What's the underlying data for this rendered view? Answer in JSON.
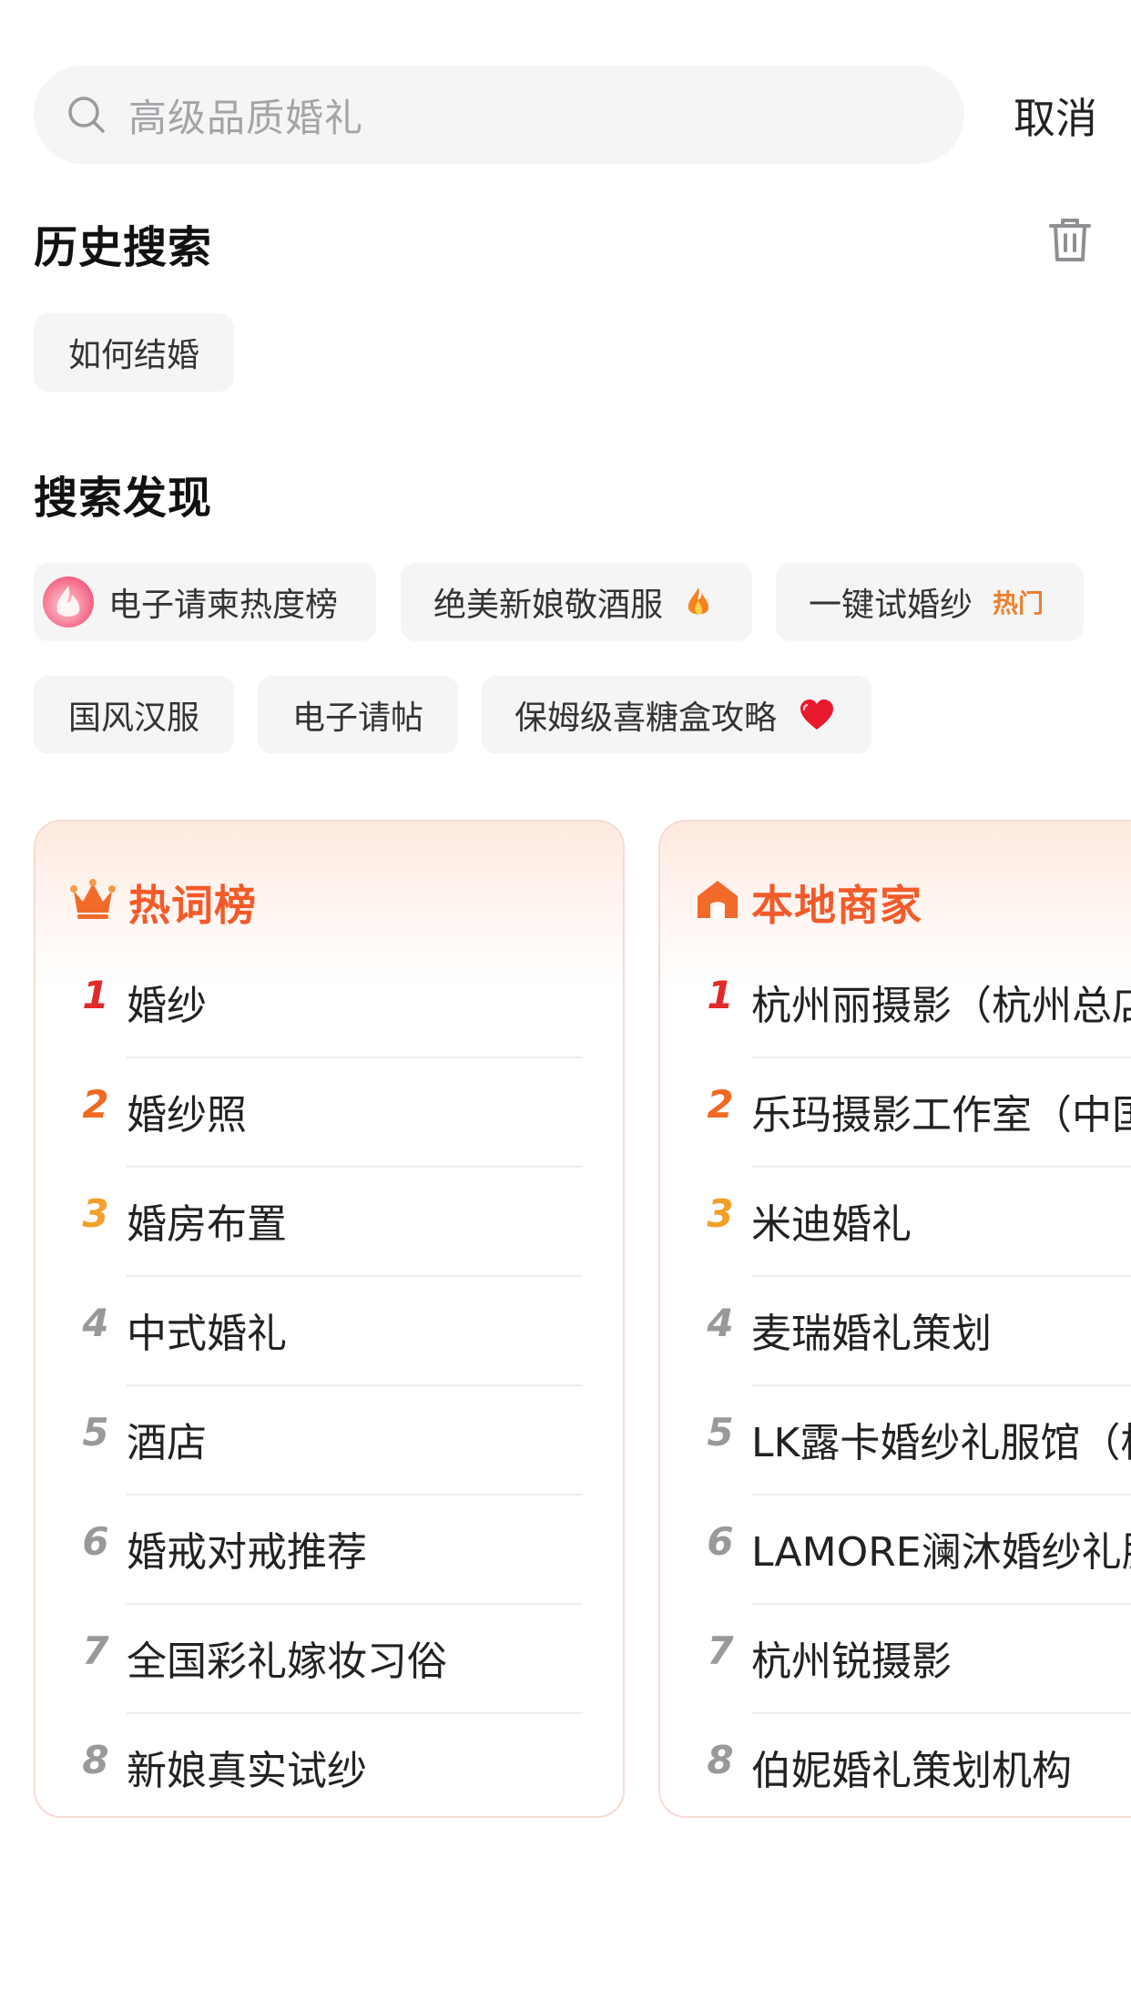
{
  "search": {
    "placeholder": "高级品质婚礼",
    "cancel_label": "取消"
  },
  "history": {
    "title": "历史搜索",
    "items": [
      "如何结婚"
    ]
  },
  "discover": {
    "title": "搜索发现",
    "items": [
      {
        "label": "电子请柬热度榜",
        "icon": "flame-badge-icon"
      },
      {
        "label": "绝美新娘敬酒服",
        "icon": "fire-icon"
      },
      {
        "label": "一键试婚纱",
        "tag": "热门"
      },
      {
        "label": "国风汉服"
      },
      {
        "label": "电子请帖"
      },
      {
        "label": "保姆级喜糖盒攻略",
        "icon": "heart-icon"
      }
    ]
  },
  "hot_words": {
    "title": "热词榜",
    "icon": "crown-icon",
    "items": [
      {
        "rank": "1",
        "label": "婚纱"
      },
      {
        "rank": "2",
        "label": "婚纱照"
      },
      {
        "rank": "3",
        "label": "婚房布置"
      },
      {
        "rank": "4",
        "label": "中式婚礼"
      },
      {
        "rank": "5",
        "label": "酒店"
      },
      {
        "rank": "6",
        "label": "婚戒对戒推荐"
      },
      {
        "rank": "7",
        "label": "全国彩礼嫁妆习俗"
      },
      {
        "rank": "8",
        "label": "新娘真实试纱"
      }
    ]
  },
  "local_merchants": {
    "title": "本地商家",
    "icon": "house-icon",
    "items": [
      {
        "rank": "1",
        "label": "杭州丽摄影（杭州总店"
      },
      {
        "rank": "2",
        "label": "乐玛摄影工作室（中国"
      },
      {
        "rank": "3",
        "label": "米迪婚礼"
      },
      {
        "rank": "4",
        "label": "麦瑞婚礼策划"
      },
      {
        "rank": "5",
        "label": "LK露卡婚纱礼服馆（杭"
      },
      {
        "rank": "6",
        "label": "LAMORE澜沐婚纱礼服"
      },
      {
        "rank": "7",
        "label": "杭州锐摄影"
      },
      {
        "rank": "8",
        "label": "伯妮婚礼策划机构"
      }
    ]
  },
  "colors": {
    "rank1": "#e02a2a",
    "rank2": "#f06a23",
    "rank3": "#f2a02b",
    "rank_other": "#999999",
    "accent": "#f35a2a"
  }
}
